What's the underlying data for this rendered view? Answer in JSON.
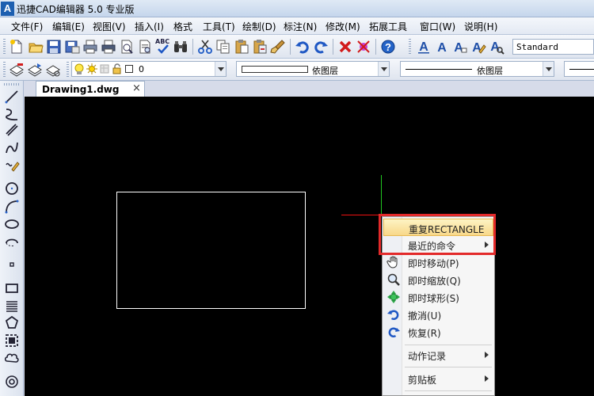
{
  "window": {
    "title": "迅捷CAD编辑器 5.0 专业版",
    "logo_text": "A"
  },
  "menubar": {
    "items": [
      {
        "label": "文件(F)"
      },
      {
        "label": "编辑(E)"
      },
      {
        "label": "视图(V)"
      },
      {
        "label": "插入(I)"
      },
      {
        "label": "格式"
      },
      {
        "label": "工具(T)"
      },
      {
        "label": "绘制(D)"
      },
      {
        "label": "标注(N)"
      },
      {
        "label": "修改(M)"
      },
      {
        "label": "拓展工具"
      },
      {
        "label": "窗口(W)"
      },
      {
        "label": "说明(H)"
      }
    ]
  },
  "toolbar": {
    "text_style": "Standard",
    "layer_value": "0",
    "color_value": "依图层",
    "linetype_value": "依图层",
    "abc_label": "ABC"
  },
  "document_tab": {
    "label": "Drawing1.dwg",
    "close": "×"
  },
  "context_menu": {
    "items": [
      {
        "label": "重复RECTANGLE"
      },
      {
        "label": "最近的命令"
      },
      {
        "label": "即时移动(P)"
      },
      {
        "label": "即时缩放(Q)"
      },
      {
        "label": "即时球形(S)"
      },
      {
        "label": "撤消(U)"
      },
      {
        "label": "恢复(R)"
      },
      {
        "label": "动作记录"
      },
      {
        "label": "剪贴板"
      }
    ]
  },
  "colors": {
    "canvas": "#000000",
    "highlight": "#f8d889",
    "annotation_box": "#e32a2a",
    "cursor_y_axis": "#21c521",
    "cursor_x_axis": "#ee1111"
  }
}
